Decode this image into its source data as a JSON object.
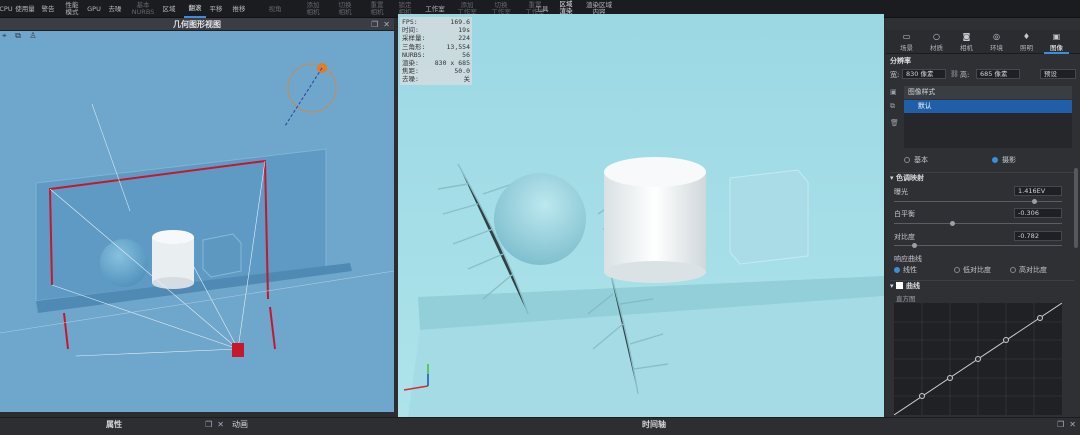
{
  "toolbar": {
    "items": [
      {
        "label": "CPU",
        "dim": false
      },
      {
        "label": "使用量",
        "dim": false
      },
      {
        "label": "警告",
        "dim": false
      },
      {
        "label": "性能\n模式",
        "dim": false
      },
      {
        "label": "GPU",
        "dim": false
      },
      {
        "label": "去噪",
        "dim": false
      },
      {
        "label": "基本\nNURBS",
        "dim": true
      },
      {
        "label": "区域",
        "dim": false
      },
      {
        "label": "翻滚",
        "dim": false,
        "active": true
      },
      {
        "label": "平移",
        "dim": false
      },
      {
        "label": "推移",
        "dim": false
      },
      {
        "label": "视角",
        "dim": true
      },
      {
        "label": "添加\n相机",
        "dim": true
      },
      {
        "label": "切换\n相机",
        "dim": true
      },
      {
        "label": "重置\n相机",
        "dim": true
      },
      {
        "label": "锁定\n相机",
        "dim": true
      },
      {
        "label": "工作室",
        "dim": false
      },
      {
        "label": "添加\n工作室",
        "dim": true
      },
      {
        "label": "切换\n工作室",
        "dim": true
      },
      {
        "label": "重置\n工作室",
        "dim": true
      },
      {
        "label": "工具",
        "dim": false
      },
      {
        "label": "区域\n渲染",
        "dim": false,
        "active": true
      },
      {
        "label": "渲染区域\n内容",
        "dim": false
      }
    ]
  },
  "left_view": {
    "title": "几何图形视图",
    "tool_icons": [
      "⌖",
      "⧉",
      "♙"
    ]
  },
  "stats": {
    "rows": [
      {
        "k": "FPS:",
        "v": "169.6"
      },
      {
        "k": "时间:",
        "v": "19s"
      },
      {
        "k": "采样量:",
        "v": "224"
      },
      {
        "k": "三角形:",
        "v": "13,554"
      },
      {
        "k": "NURBS:",
        "v": "56"
      },
      {
        "k": "渲染:",
        "v": "830 x 685"
      },
      {
        "k": "焦距:",
        "v": "50.0"
      },
      {
        "k": "去噪:",
        "v": "关"
      }
    ]
  },
  "right_panel": {
    "left_title": "项目",
    "title": "图像",
    "tabs": [
      {
        "label": "场景",
        "icon": "▭"
      },
      {
        "label": "材质",
        "icon": "○"
      },
      {
        "label": "相机",
        "icon": "◙"
      },
      {
        "label": "环境",
        "icon": "◎"
      },
      {
        "label": "照明",
        "icon": "♦"
      },
      {
        "label": "图像",
        "icon": "▣",
        "active": true
      }
    ],
    "resolution_label": "分辨率",
    "width_label": "宽:",
    "width_value": "830 像素",
    "height_label": "高:",
    "height_value": "685 像素",
    "preset_label": "预设",
    "styles_header": "图像样式",
    "style_item": "默认",
    "mode_basic": "基本",
    "mode_photo": "摄影",
    "tone_section": "色调映射",
    "exposure_label": "曝光",
    "exposure_value": "1.416EV",
    "whitepoint_label": "白平衡",
    "whitepoint_value": "-0.306",
    "contrast_label": "对比度",
    "contrast_value": "-0.782",
    "response_label": "响应曲线",
    "curve_linear": "线性",
    "curve_low": "低对比度",
    "curve_high": "高对比度",
    "curve_section": "曲线",
    "histogram_label": "直方图"
  },
  "bottom": {
    "props": "属性",
    "anim": "动画",
    "timeline": "时间轴"
  },
  "colors": {
    "accent": "#3b8ede"
  }
}
